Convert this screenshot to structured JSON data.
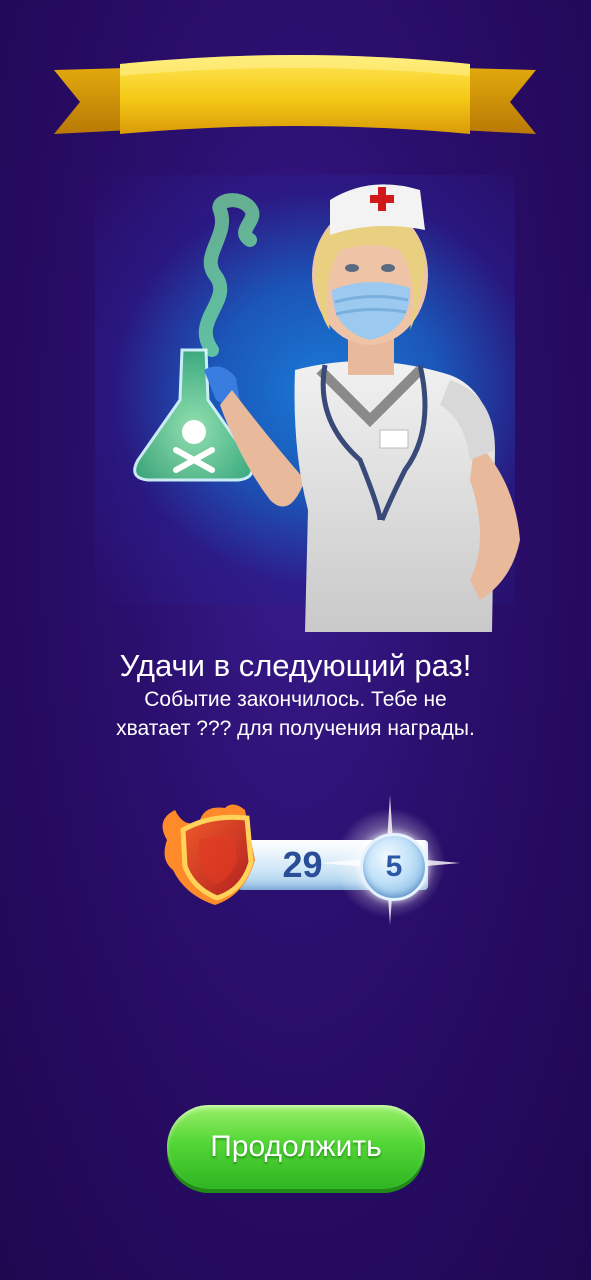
{
  "screen": {
    "title": "Удачи в следующий раз!",
    "message": "Событие закончилось. Тебе не хватает ??? для получения награды."
  },
  "progress": {
    "count": "29",
    "level": "5",
    "badge_icon": "flame-shield-icon",
    "level_icon": "level-orb-icon"
  },
  "hero": {
    "illustration": "nurse-with-poison-flask"
  },
  "actions": {
    "continue_label": "Продолжить"
  },
  "colors": {
    "background": "#250a5e",
    "banner": "#f5d21c",
    "button": "#4fd334",
    "count_text": "#2a4d98"
  }
}
